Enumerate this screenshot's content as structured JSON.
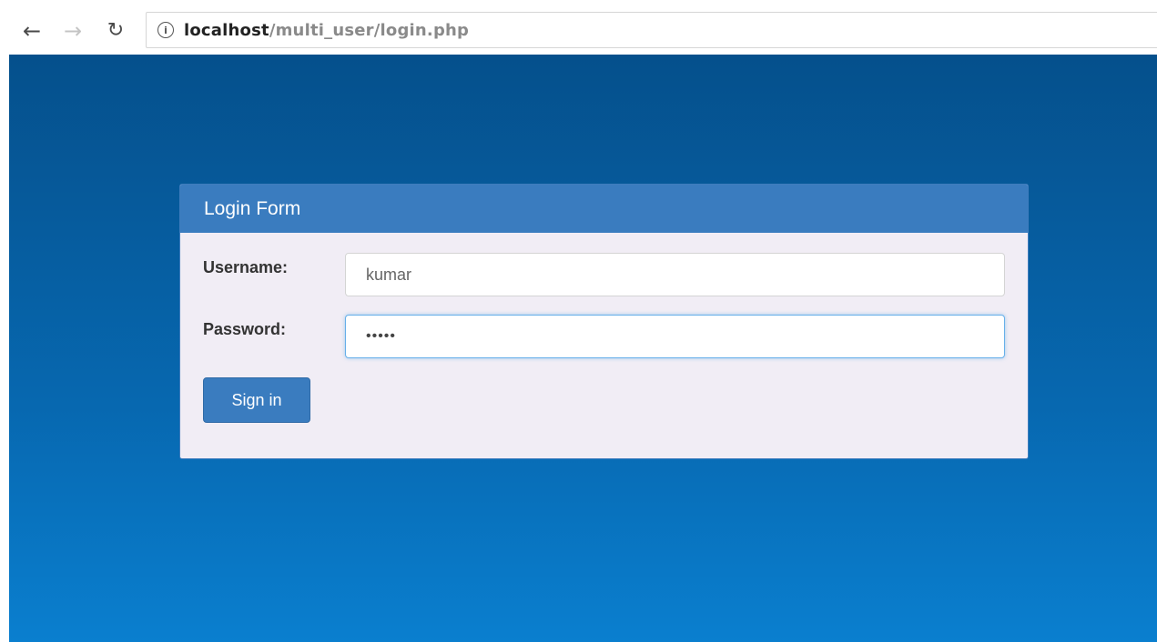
{
  "browser": {
    "url_host": "localhost",
    "url_path": "/multi_user/login.php"
  },
  "icons": {
    "back": "arrow-left-icon",
    "forward": "arrow-right-icon",
    "reload": "reload-icon",
    "info": "info-icon"
  },
  "login_form": {
    "heading": "Login Form",
    "username_label": "Username:",
    "username_value": "kumar",
    "password_label": "Password:",
    "password_value": "•••••",
    "submit_label": "Sign in"
  },
  "colors": {
    "panel_heading": "#3a7cbf",
    "background_top": "#05508c",
    "background_bottom": "#0a7fcf",
    "panel_body": "#f1edf5"
  }
}
